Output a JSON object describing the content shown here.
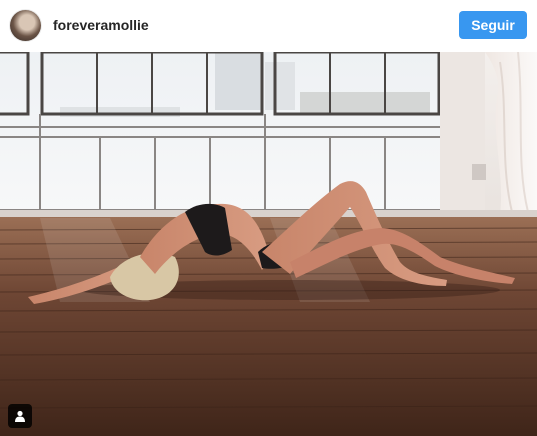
{
  "post": {
    "username": "foreveramollie",
    "follow_label": "Seguir"
  },
  "icons": {
    "avatar": "profile-avatar",
    "tag": "user-tag-icon"
  },
  "colors": {
    "follow_button": "#3897f0",
    "username_text": "#262626"
  }
}
